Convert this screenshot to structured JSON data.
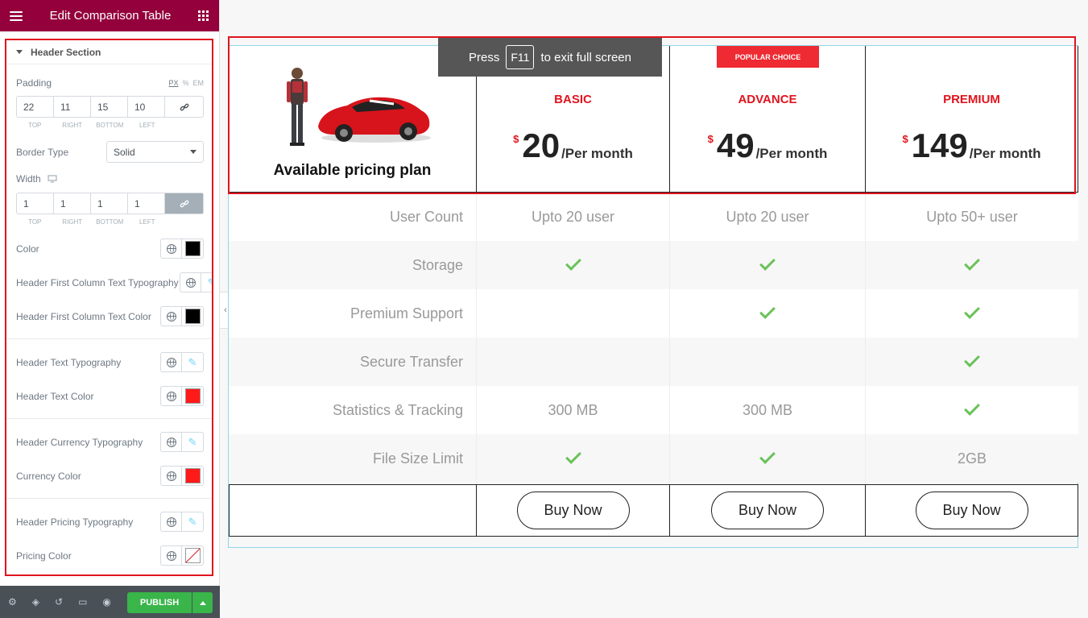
{
  "panel": {
    "title": "Edit Comparison Table",
    "section": "Header Section",
    "padding": {
      "label": "Padding",
      "units": [
        "PX",
        "%",
        "EM"
      ],
      "values": [
        "22",
        "11",
        "15",
        "10"
      ],
      "sides": [
        "TOP",
        "RIGHT",
        "BOTTOM",
        "LEFT"
      ]
    },
    "border_type": {
      "label": "Border Type",
      "value": "Solid"
    },
    "width": {
      "label": "Width",
      "values": [
        "1",
        "1",
        "1",
        "1"
      ],
      "sides": [
        "TOP",
        "RIGHT",
        "BOTTOM",
        "LEFT"
      ]
    },
    "controls": [
      {
        "label": "Color",
        "swatch": "#000000"
      },
      {
        "label": "Header First Column Text Typography"
      },
      {
        "label": "Header First Column Text Color",
        "swatch": "#000000"
      },
      {
        "label": "Header Text Typography"
      },
      {
        "label": "Header Text Color",
        "swatch": "#ff1a1a"
      },
      {
        "label": "Header Currency Typography"
      },
      {
        "label": "Currency Color",
        "swatch": "#ff1a1a"
      },
      {
        "label": "Header Pricing Typography"
      },
      {
        "label": "Pricing Color",
        "swatch": "none"
      }
    ],
    "publish_label": "PUBLISH"
  },
  "fullscreen": {
    "press": "Press",
    "key": "F11",
    "rest": "to exit full screen"
  },
  "table": {
    "first_header": "Available pricing plan",
    "badge": "POPULAR CHOICE",
    "plans": [
      {
        "name": "BASIC",
        "currency": "$",
        "amount": "20",
        "per": "/Per month"
      },
      {
        "name": "ADVANCE",
        "currency": "$",
        "amount": "49",
        "per": "/Per month"
      },
      {
        "name": "PREMIUM",
        "currency": "$",
        "amount": "149",
        "per": "/Per month"
      }
    ],
    "rows": [
      {
        "label": "User Count",
        "values": [
          "Upto 20 user",
          "Upto 20 user",
          "Upto 50+ user"
        ]
      },
      {
        "label": "Storage",
        "values": [
          "check",
          "check",
          "check"
        ]
      },
      {
        "label": "Premium Support",
        "values": [
          "",
          "check",
          "check"
        ]
      },
      {
        "label": "Secure Transfer",
        "values": [
          "",
          "",
          "check"
        ]
      },
      {
        "label": "Statistics & Tracking",
        "values": [
          "300 MB",
          "300 MB",
          "check"
        ]
      },
      {
        "label": "File Size Limit",
        "values": [
          "check",
          "check",
          "2GB"
        ]
      }
    ],
    "buy_label": "Buy Now"
  },
  "colors": {
    "brand": "#93003c",
    "accent_red": "#e0141e",
    "check_green": "#6ac259",
    "publish_green": "#39b54a"
  }
}
